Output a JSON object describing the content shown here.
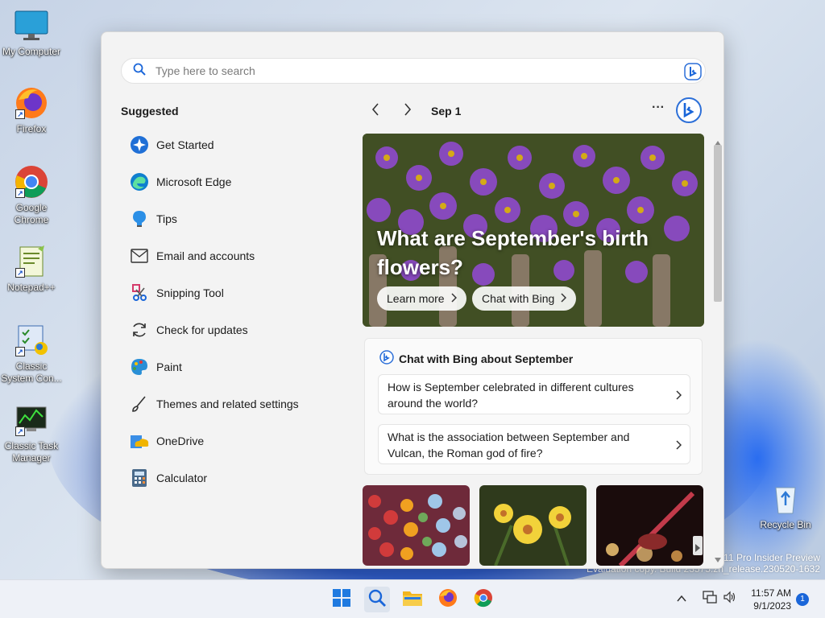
{
  "desktop": {
    "icons": [
      {
        "label": "My Computer",
        "icon": "monitor-icon"
      },
      {
        "label": "Firefox",
        "icon": "firefox-icon"
      },
      {
        "label": "Google Chrome",
        "icon": "chrome-icon"
      },
      {
        "label": "Notepad++",
        "icon": "notepadpp-icon"
      },
      {
        "label": "Classic System Con...",
        "icon": "control-panel-icon"
      },
      {
        "label": "Classic Task Manager",
        "icon": "task-manager-icon"
      },
      {
        "label": "Recycle Bin",
        "icon": "recycle-bin-icon"
      }
    ],
    "watermark_line1": "11 Pro Insider Preview",
    "watermark_line2": "Evaluation copy. Build 23575.zn_release.230520-1632"
  },
  "search": {
    "placeholder": "Type here to search"
  },
  "suggested": {
    "title": "Suggested",
    "items": [
      {
        "label": "Get Started",
        "icon": "get-started-icon"
      },
      {
        "label": "Microsoft Edge",
        "icon": "edge-icon"
      },
      {
        "label": "Tips",
        "icon": "tips-icon"
      },
      {
        "label": "Email and accounts",
        "icon": "mail-icon"
      },
      {
        "label": "Snipping Tool",
        "icon": "snipping-tool-icon"
      },
      {
        "label": "Check for updates",
        "icon": "refresh-icon"
      },
      {
        "label": "Paint",
        "icon": "paint-icon"
      },
      {
        "label": "Themes and related settings",
        "icon": "brush-icon"
      },
      {
        "label": "OneDrive",
        "icon": "onedrive-icon"
      },
      {
        "label": "Calculator",
        "icon": "calculator-icon"
      }
    ]
  },
  "highlights": {
    "date": "Sep 1",
    "more": "···",
    "hero_title": "What are September's birth flowers?",
    "learn_more": "Learn more",
    "chat_with_bing": "Chat with Bing",
    "chat_card_title": "Chat with Bing about September",
    "questions": [
      "How is September celebrated in different cultures around the world?",
      "What is the association between September and Vulcan, the Roman god of fire?"
    ]
  },
  "taskbar": {
    "time": "11:57 AM",
    "date": "9/1/2023",
    "notification_count": "1"
  },
  "colors": {
    "accent": "#1a66d9",
    "panel": "#f3f3f3",
    "taskbar": "#eef1f7"
  }
}
